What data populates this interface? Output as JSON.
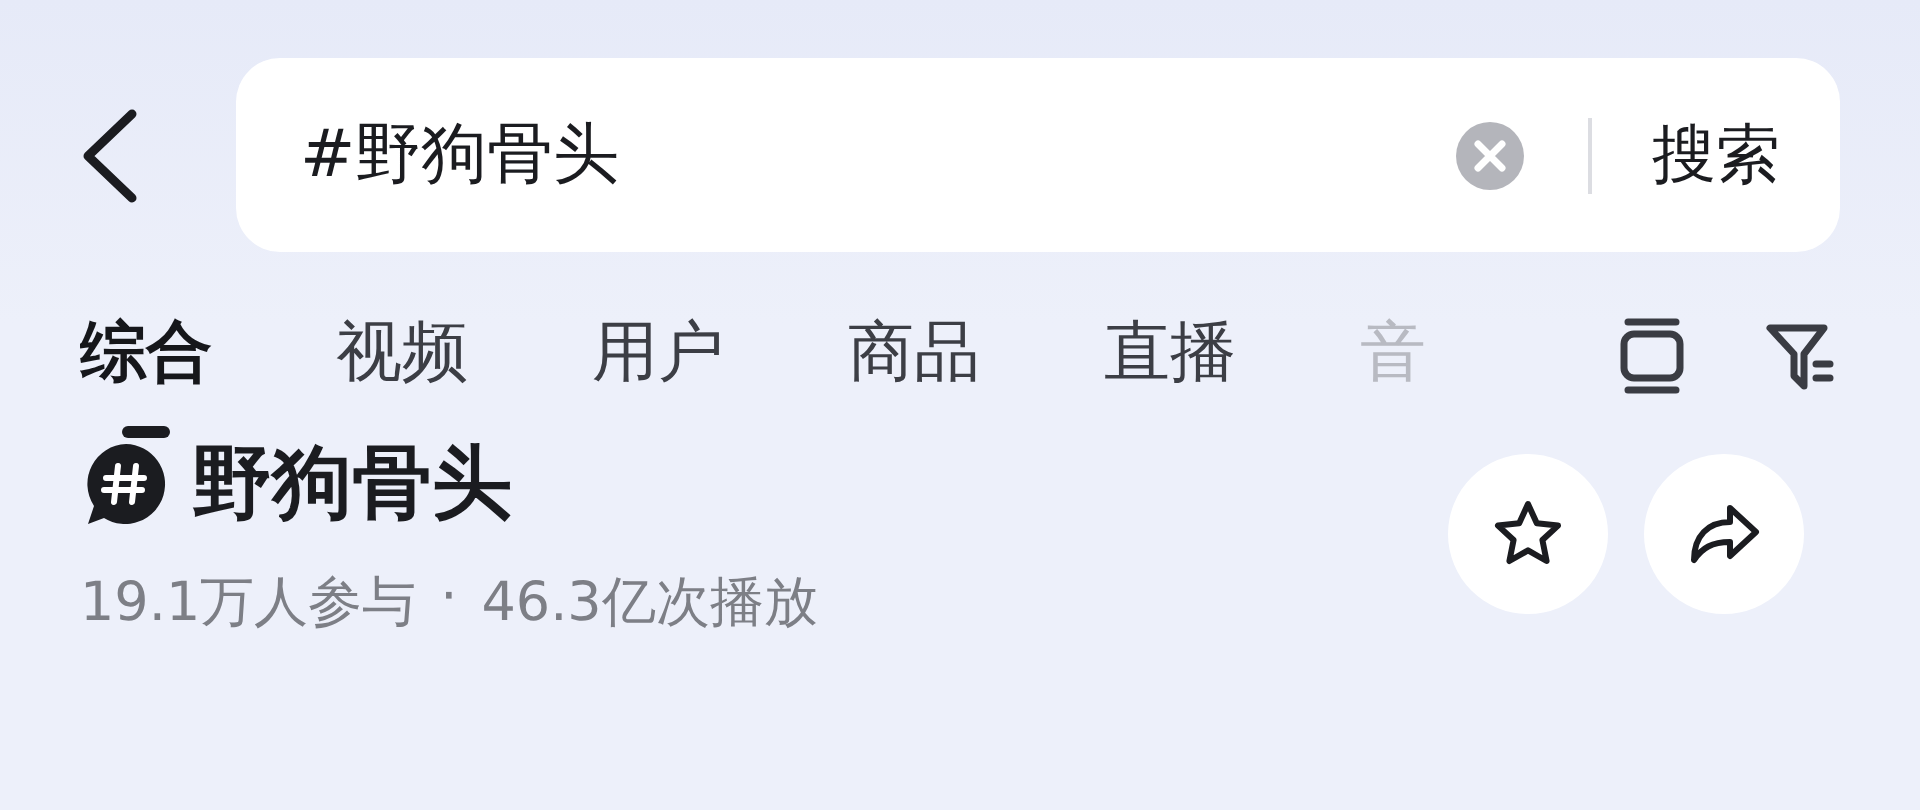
{
  "search": {
    "value": "#野狗骨头",
    "action": "搜索"
  },
  "tabs": [
    {
      "label": "综合",
      "selected": true
    },
    {
      "label": "视频",
      "selected": false
    },
    {
      "label": "用户",
      "selected": false
    },
    {
      "label": "商品",
      "selected": false
    },
    {
      "label": "直播",
      "selected": false
    },
    {
      "label": "音",
      "selected": false
    }
  ],
  "topic": {
    "title": "野狗骨头",
    "participants": "19.1万人参与",
    "separator": "·",
    "plays": "46.3亿次播放"
  }
}
